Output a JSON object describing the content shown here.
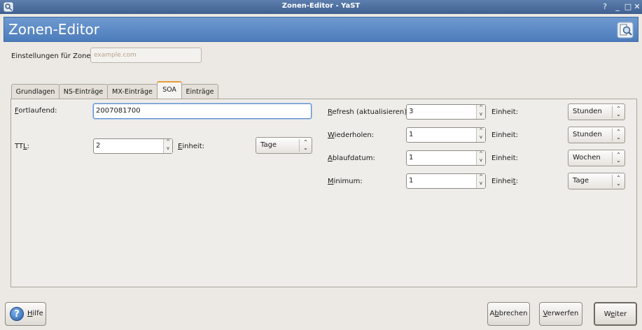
{
  "window": {
    "title": "Zonen-Editor - YaST"
  },
  "header": {
    "title": "Zonen-Editor"
  },
  "zone": {
    "label": "Einstellungen für Zone",
    "placeholder": "example.com"
  },
  "tabs": [
    {
      "label": "Grundlagen"
    },
    {
      "label": "NS-Einträge"
    },
    {
      "label": "MX-Einträge"
    },
    {
      "label": "SOA"
    },
    {
      "label": "Einträge"
    }
  ],
  "soa": {
    "serial": {
      "label_u": "F",
      "label_rest": "ortlaufend:",
      "value": "2007081700"
    },
    "ttl": {
      "label_a": "TT",
      "label_u": "L",
      "label_b": ":",
      "value": "2",
      "unit_label_u": "E",
      "unit_label_rest": "inheit:",
      "unit": "Tage"
    },
    "refresh": {
      "label_u": "R",
      "label_rest": "efresh (aktualisieren):",
      "value": "3",
      "unit_label": "Einheit:",
      "unit": "Stunden"
    },
    "retry": {
      "label_u": "W",
      "label_rest": "iederholen:",
      "value": "1",
      "unit_label": "Einheit:",
      "unit": "Stunden"
    },
    "expiry": {
      "label_u": "A",
      "label_rest": "blaufdatum:",
      "value": "1",
      "unit_label": "Einheit:",
      "unit": "Wochen"
    },
    "minimum": {
      "label_u": "M",
      "label_rest": "inimum:",
      "value": "1",
      "unit_label_a": "Einhei",
      "unit_label_u": "t",
      "unit_label_b": ":",
      "unit": "Tage"
    }
  },
  "buttons": {
    "help": {
      "label": "Hilfe",
      "u": "H"
    },
    "cancel": {
      "label_a": "A",
      "label_u": "b",
      "label_b": "brechen"
    },
    "discard": {
      "label_u": "V",
      "label_rest": "erwerfen"
    },
    "next": {
      "label_a": "W",
      "label_u": "e",
      "label_b": "iter"
    }
  }
}
